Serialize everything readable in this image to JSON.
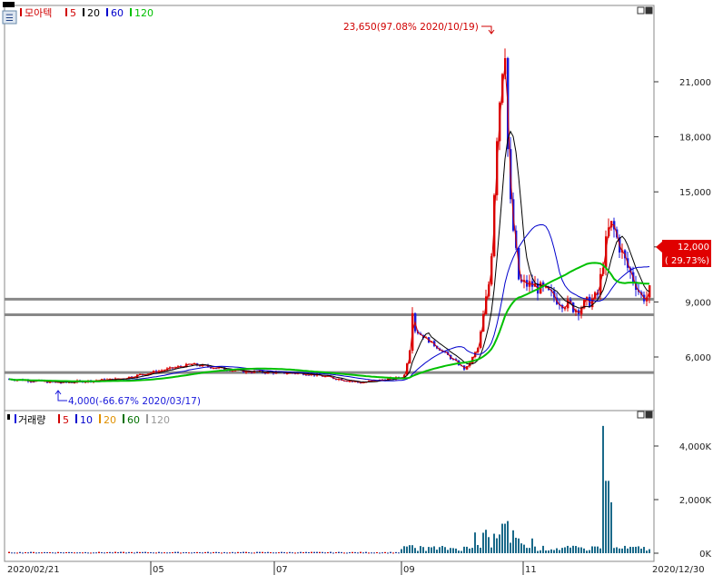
{
  "price_panel": {
    "legend": {
      "name": "모아텍",
      "ma_labels": [
        "5",
        "20",
        "60",
        "120"
      ],
      "ma_colors": [
        "#d00000",
        "#000000",
        "#0000cc",
        "#00c000"
      ]
    },
    "max_annotation": "23,650(97.08% 2020/10/19)",
    "min_annotation": "4,000(-66.67% 2020/03/17)",
    "current_price_label": "12,000",
    "current_change_label": "( 29.73%)"
  },
  "volume_panel": {
    "legend": {
      "name": "거래량",
      "ma_labels": [
        "5",
        "10",
        "20",
        "60",
        "120"
      ],
      "ma_colors": [
        "#d00000",
        "#0000cc",
        "#e09000",
        "#007000",
        "#999999"
      ]
    }
  },
  "colors": {
    "up": "#e00000",
    "down": "#1a1adb",
    "accent_box": "#e00000"
  },
  "chart_data": [
    {
      "type": "candlestick",
      "y_ticks": [
        6000,
        9000,
        12000,
        15000,
        18000,
        21000
      ],
      "y_tick_labels": [
        "6,000",
        "9,000",
        "12,000",
        "15,000",
        "18,000",
        "21,000"
      ],
      "ylim": [
        4000,
        24500
      ],
      "horizontal_lines": [
        9150,
        8300,
        5150
      ],
      "x_labels": [
        "2020/02/21",
        "05",
        "07",
        "09",
        "11",
        "2020/12/30"
      ],
      "series_close_approx": [
        [
          "2020/02/21",
          4800
        ],
        [
          "2020/03/17",
          4600
        ],
        [
          "2020/04/15",
          4800
        ],
        [
          "2020/05/20",
          5600
        ],
        [
          "2020/06/15",
          5200
        ],
        [
          "2020/07/15",
          5100
        ],
        [
          "2020/08/10",
          4600
        ],
        [
          "2020/08/31",
          4900
        ],
        [
          "2020/09/03",
          6500
        ],
        [
          "2020/09/04",
          9000
        ],
        [
          "2020/09/05",
          7500
        ],
        [
          "2020/09/20",
          6200
        ],
        [
          "2020/09/30",
          5300
        ],
        [
          "2020/10/06",
          6500
        ],
        [
          "2020/10/12",
          10500
        ],
        [
          "2020/10/15",
          18000
        ],
        [
          "2020/10/19",
          23650
        ],
        [
          "2020/10/21",
          15000
        ],
        [
          "2020/10/26",
          10000
        ],
        [
          "2020/11/02",
          9900
        ],
        [
          "2020/11/16",
          9000
        ],
        [
          "2020/11/23",
          8600
        ],
        [
          "2020/12/03",
          9300
        ],
        [
          "2020/12/08",
          12800
        ],
        [
          "2020/12/10",
          13200
        ],
        [
          "2020/12/17",
          11000
        ],
        [
          "2020/12/22",
          9900
        ],
        [
          "2020/12/24",
          9300
        ],
        [
          "2020/12/28",
          9250
        ],
        [
          "2020/12/30",
          12000
        ]
      ]
    },
    {
      "type": "bar",
      "y_ticks": [
        0,
        2000,
        4000
      ],
      "y_tick_labels": [
        "0K",
        "2,000K",
        "4,000K"
      ],
      "ylim": [
        0,
        5000
      ],
      "series_approx": [
        [
          "2020/09/04",
          300
        ],
        [
          "2020/10/12",
          600
        ],
        [
          "2020/10/19",
          1100
        ],
        [
          "2020/10/21",
          1200
        ],
        [
          "2020/11/02",
          550
        ],
        [
          "2020/12/03",
          250
        ],
        [
          "2020/12/07",
          4750
        ],
        [
          "2020/12/08",
          2700
        ],
        [
          "2020/12/10",
          1900
        ],
        [
          "2020/12/30",
          1950
        ]
      ]
    }
  ]
}
